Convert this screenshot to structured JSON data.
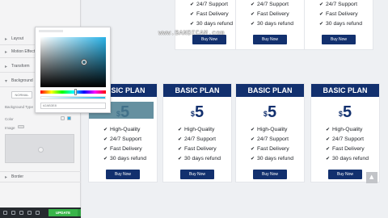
{
  "editor": {
    "sections": [
      {
        "label": "Layout"
      },
      {
        "label": "Motion Effects"
      },
      {
        "label": "Transform"
      },
      {
        "label": "Background"
      }
    ],
    "bottom_sections": [
      {
        "label": "Border"
      }
    ],
    "normal_button": "NORMAL",
    "background_type_label": "Background Type",
    "color_label": "Color",
    "image_label": "Image",
    "update_button": "UPDATE",
    "hex_value": "#2AB3E8"
  },
  "preview": {
    "watermark": "www.BANDICAM.com",
    "top_row": [
      {
        "features": [
          "24/7 Support",
          "Fast Delivery",
          "30 days refund"
        ],
        "button": "Buy Now"
      },
      {
        "features": [
          "24/7 Support",
          "Fast Delivery",
          "30 days refund"
        ],
        "button": "Buy Now"
      },
      {
        "features": [
          "24/7 Support",
          "Fast Delivery",
          "30 days refund"
        ],
        "button": "Buy Now"
      }
    ],
    "cards": [
      {
        "title": "BASIC PLAN",
        "currency": "$",
        "price": "5",
        "features": [
          "High-Quality",
          "24/7 Support",
          "Fast Delivery",
          "30 days refund"
        ],
        "button": "Buy Now"
      },
      {
        "title": "BASIC PLAN",
        "currency": "$",
        "price": "5",
        "features": [
          "High-Quality",
          "24/7 Support",
          "Fast Delivery",
          "30 days refund"
        ],
        "button": "Buy Now"
      },
      {
        "title": "BASIC PLAN",
        "currency": "$",
        "price": "5",
        "features": [
          "High-Quality",
          "24/7 Support",
          "Fast Delivery",
          "30 days refund"
        ],
        "button": "Buy Now"
      },
      {
        "title": "BASIC PLAN",
        "currency": "$",
        "price": "5",
        "features": [
          "High-Quality",
          "24/7 Support",
          "Fast Delivery",
          "30 days refund"
        ],
        "button": "Buy Now"
      }
    ]
  },
  "colors": {
    "brand_navy": "#12306e",
    "picker_color": "#2ab3e8",
    "update_green": "#39b54a"
  }
}
